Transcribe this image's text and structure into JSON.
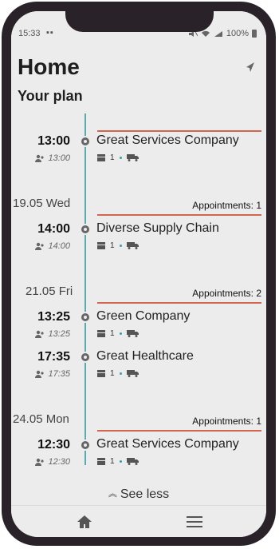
{
  "status": {
    "time": "15:33",
    "dots": "▪▪",
    "battery": "100%"
  },
  "header": {
    "title": "Home",
    "subtitle": "Your plan"
  },
  "plan": {
    "first": {
      "start": "13:00",
      "end": "13:00",
      "company": "Great Services Company",
      "count": "1"
    },
    "groups": [
      {
        "date": "19.05 Wed",
        "appointments": "Appointments: 1",
        "items": [
          {
            "start": "14:00",
            "end": "14:00",
            "company": "Diverse Supply Chain",
            "count": "1"
          }
        ]
      },
      {
        "date": "21.05 Fri",
        "appointments": "Appointments: 2",
        "items": [
          {
            "start": "13:25",
            "end": "13:25",
            "company": "Green Company",
            "count": "1"
          },
          {
            "start": "17:35",
            "end": "17:35",
            "company": "Great Healthcare",
            "count": "1"
          }
        ]
      },
      {
        "date": "24.05 Mon",
        "appointments": "Appointments: 1",
        "items": [
          {
            "start": "12:30",
            "end": "12:30",
            "company": "Great Services Company",
            "count": "1"
          }
        ]
      }
    ],
    "see_less": "See less"
  },
  "icons": {
    "send": "send-icon",
    "person": "person-icon",
    "box": "package-icon",
    "truck": "truck-icon",
    "home": "home-icon",
    "menu": "menu-icon"
  },
  "colors": {
    "accent_line": "#d2674e",
    "timeline": "#5aaab0",
    "background": "#ececec"
  }
}
